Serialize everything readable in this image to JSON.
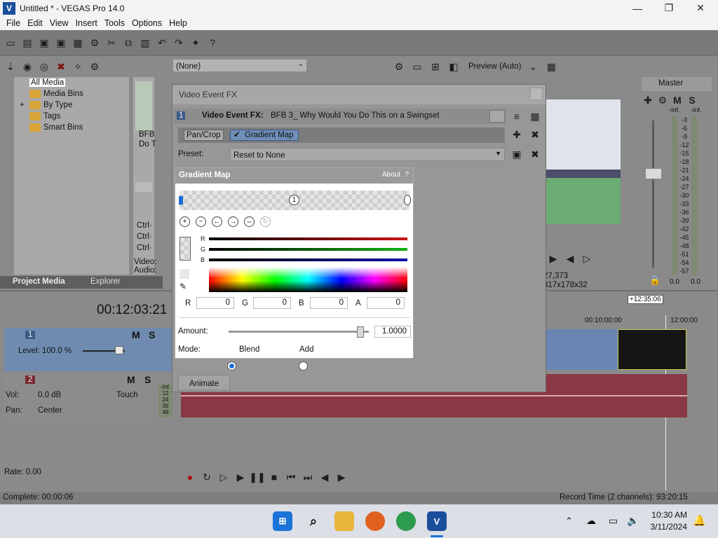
{
  "window": {
    "title": "Untitled * - VEGAS Pro 14.0",
    "logo": "V"
  },
  "menu": [
    "File",
    "Edit",
    "View",
    "Insert",
    "Tools",
    "Options",
    "Help"
  ],
  "media_tree": {
    "items": [
      {
        "label": "All Media",
        "selected": true
      },
      {
        "label": "Media Bins"
      },
      {
        "label": "By Type",
        "expander": "+"
      },
      {
        "label": "Tags"
      },
      {
        "label": "Smart Bins"
      }
    ],
    "thumb_label_1": "BFB",
    "thumb_label_2": "Do T",
    "ctrl_labels": [
      "Ctrl·",
      "Ctrl·",
      "Ctrl·"
    ],
    "video_label": "Video:",
    "audio_label": "Audio:"
  },
  "tabs": {
    "project_media": "Project Media",
    "explorer": "Explorer"
  },
  "preset_top": {
    "value": "(None)"
  },
  "preview": {
    "mode": "Preview (Auto)",
    "frame": "27,373",
    "size": "317x178x32"
  },
  "master": {
    "label": "Master",
    "db_labels": [
      "-Inf.",
      "-Inf."
    ],
    "scale": [
      "3",
      "6",
      "9",
      "12",
      "15",
      "18",
      "21",
      "24",
      "27",
      "30",
      "33",
      "36",
      "39",
      "42",
      "45",
      "48",
      "51",
      "54",
      "57"
    ],
    "bottom": [
      "0.0",
      "0.0"
    ]
  },
  "timeline": {
    "timecode": "00:12:03:21",
    "marker_badge": "+12:35:06",
    "ruler": [
      "00:10:00:00",
      "12:00:00"
    ],
    "track1": {
      "number": "1",
      "level": "Level: 100.0 %",
      "m": "M",
      "s": "S"
    },
    "track2": {
      "number": "2",
      "vol_label": "Vol:",
      "vol_value": "0.0 dB",
      "pan_label": "Pan:",
      "pan_value": "Center",
      "touch": "Touch",
      "m": "M",
      "s": "S",
      "meter": [
        "-Inf.",
        "12",
        "24",
        "36",
        "48"
      ]
    },
    "rate": "Rate: 0.00"
  },
  "status": {
    "left": "Complete: 00:00:06",
    "right": "Record Time (2 channels): 93:20:15"
  },
  "fx_dialog": {
    "title": "Video Event FX",
    "chain_number": "1",
    "chain_label": "Video Event FX:",
    "chain_name": "BFB 3_ Why Would You Do This on a Swingset",
    "plugins": [
      "Pan/Crop",
      "Gradient Map"
    ],
    "preset_label": "Preset:",
    "preset_value": "Reset to None",
    "animate": "Animate"
  },
  "gradient_map": {
    "title": "Gradient Map",
    "about": "About",
    "help": "?",
    "stop_label": "1",
    "channels": [
      "R",
      "G",
      "B"
    ],
    "rgba": {
      "R": "0",
      "G": "0",
      "B": "0",
      "A": "0"
    },
    "amount_label": "Amount:",
    "amount_value": "1.0000",
    "amount_fraction": 0.94,
    "mode_label": "Mode:",
    "mode_blend": "Blend",
    "mode_add": "Add",
    "colors": {
      "red": "#cc1111",
      "green": "#11b011",
      "blue": "#1111aa",
      "accent": "#1a6fd6"
    }
  },
  "taskbar": {
    "time": "10:30 AM",
    "date": "3/11/2024"
  }
}
